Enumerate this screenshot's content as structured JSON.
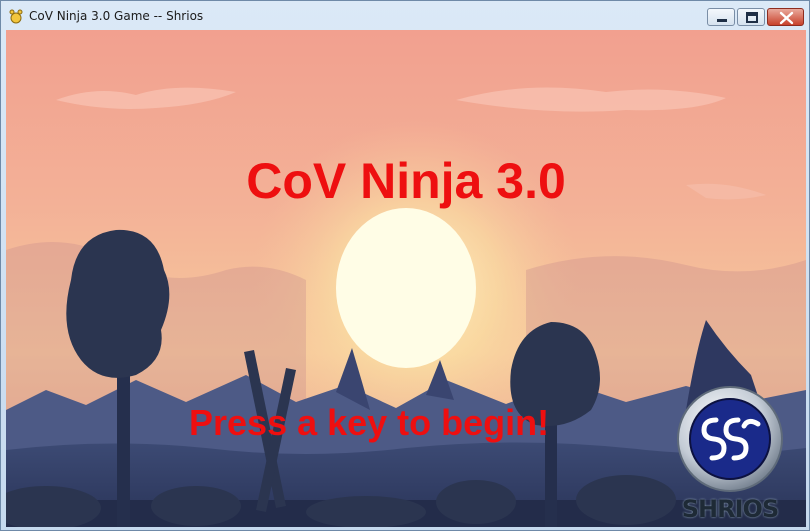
{
  "window": {
    "title": "CoV Ninja 3.0 Game -- Shrios",
    "controls": {
      "minimize": "minimize",
      "maximize": "maximize",
      "close": "close"
    }
  },
  "game": {
    "title": "CoV Ninja 3.0",
    "prompt": "Press a key to begin!",
    "logo_caption": "SHRIOS",
    "text_color": "#ee0f10"
  },
  "colors": {
    "sky_top": "#f2a08f",
    "sky_mid": "#f7c39a",
    "sun": "#fffde6",
    "silhouette": "#2b3550"
  },
  "icons": [
    "app-icon",
    "minimize-icon",
    "maximize-icon",
    "close-icon",
    "shrios-logo"
  ]
}
